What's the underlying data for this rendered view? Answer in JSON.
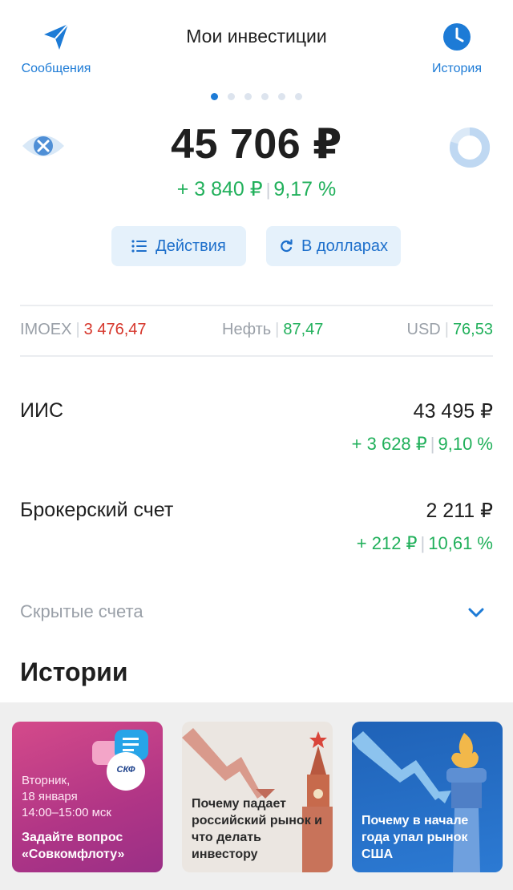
{
  "header": {
    "title": "Мои инвестиции",
    "left_label": "Сообщения",
    "right_label": "История"
  },
  "pager": {
    "count": 6,
    "active": 0
  },
  "balance": {
    "total": "45 706 ₽",
    "gain_abs": "+ 3 840 ₽",
    "gain_pct": "9,17 %"
  },
  "buttons": {
    "actions": "Действия",
    "usd": "В долларах"
  },
  "ticker": {
    "imoex_label": "IMOEX",
    "imoex_value": "3 476,47",
    "oil_label": "Нефть",
    "oil_value": "87,47",
    "usd_label": "USD",
    "usd_value": "76,53"
  },
  "accounts": [
    {
      "name": "ИИС",
      "value": "43 495 ₽",
      "gain_abs": "+ 3 628 ₽",
      "gain_pct": "9,10 %"
    },
    {
      "name": "Брокерский счет",
      "value": "2 211 ₽",
      "gain_abs": "+ 212 ₽",
      "gain_pct": "10,61 %"
    }
  ],
  "hidden_accounts": "Скрытые счета",
  "stories": {
    "title": "Истории",
    "items": [
      {
        "date": "Вторник,\n18 января\n14:00–15:00 мск",
        "text": "Задайте вопрос «Совкомфлоту»",
        "logo": "СКФ"
      },
      {
        "text": "Почему падает российский рынок и что делать инвестору"
      },
      {
        "text": "Почему в начале года упал рынок США"
      }
    ]
  },
  "colors": {
    "accent": "#1d7bd6",
    "positive": "#21b05b",
    "negative": "#d6372c",
    "muted": "#9aa0a8"
  },
  "icons": {
    "left": "paper-plane-icon",
    "right": "clock-icon",
    "eye": "eye-hidden-icon",
    "donut": "portfolio-donut-icon",
    "actions": "list-icon",
    "usd": "refresh-icon",
    "chevron": "chevron-down-icon"
  }
}
